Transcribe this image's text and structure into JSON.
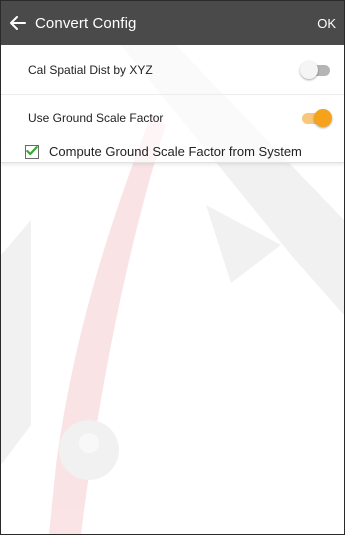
{
  "header": {
    "title": "Convert Config",
    "ok_label": "OK",
    "back_icon": "arrow-left-icon",
    "background_color": "#4a4a4a"
  },
  "settings": [
    {
      "label": "Cal Spatial Dist by XYZ",
      "toggle_on": false
    },
    {
      "label": "Use Ground Scale Factor",
      "toggle_on": true
    }
  ],
  "checkbox": {
    "label": "Compute Ground Scale Factor from System",
    "checked": true,
    "icon": "check-icon",
    "check_color": "#3aa83a"
  },
  "colors": {
    "toggle_on_thumb": "#f7a21b",
    "toggle_on_track": "#f8c77a",
    "toggle_off_track": "#b5b5b5",
    "watermark_red": "#e0313a",
    "watermark_gray": "#9a9a9a"
  }
}
